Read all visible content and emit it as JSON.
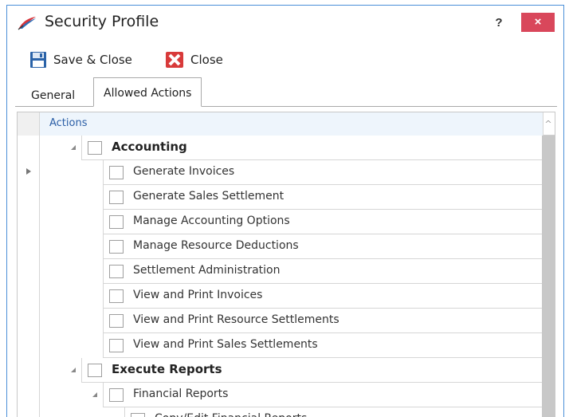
{
  "window": {
    "title": "Security Profile",
    "help": "?",
    "close": "×"
  },
  "toolbar": {
    "save_label": "Save & Close",
    "close_label": "Close"
  },
  "tabs": [
    {
      "label": "General",
      "active": false
    },
    {
      "label": "Allowed Actions",
      "active": true
    }
  ],
  "grid": {
    "column_header": "Actions",
    "rows": [
      {
        "label": "Accounting",
        "level": 0,
        "bold": true,
        "expanded": true,
        "checked": false
      },
      {
        "label": "Generate Invoices",
        "level": 1,
        "bold": false,
        "checked": false
      },
      {
        "label": "Generate Sales Settlement",
        "level": 1,
        "bold": false,
        "checked": false
      },
      {
        "label": "Manage Accounting Options",
        "level": 1,
        "bold": false,
        "checked": false
      },
      {
        "label": "Manage Resource Deductions",
        "level": 1,
        "bold": false,
        "checked": false
      },
      {
        "label": "Settlement Administration",
        "level": 1,
        "bold": false,
        "checked": false
      },
      {
        "label": "View and Print Invoices",
        "level": 1,
        "bold": false,
        "checked": false
      },
      {
        "label": "View and Print Resource Settlements",
        "level": 1,
        "bold": false,
        "checked": false
      },
      {
        "label": "View and Print Sales Settlements",
        "level": 1,
        "bold": false,
        "checked": false
      },
      {
        "label": "Execute Reports",
        "level": 0,
        "bold": true,
        "expanded": true,
        "checked": false
      },
      {
        "label": "Financial Reports",
        "level": 1,
        "bold": false,
        "expanded": true,
        "checked": false
      },
      {
        "label": "Copy/Edit Financial Reports",
        "level": 2,
        "bold": false,
        "checked": false
      }
    ]
  },
  "colors": {
    "accent": "#4a8fd8",
    "close_button": "#d9475b",
    "header_bg": "#eef5fc",
    "header_text": "#2b5ea6"
  },
  "icons": {
    "app": "profile-feather-icon",
    "save": "save-disk-icon",
    "close": "close-red-icon"
  }
}
